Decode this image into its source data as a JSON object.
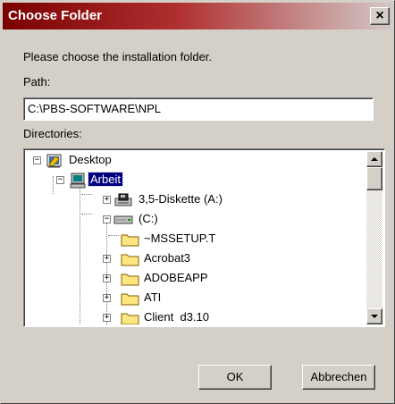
{
  "window": {
    "title": "Choose Folder",
    "close_glyph": "×"
  },
  "prompt": "Please choose the installation folder.",
  "path": {
    "label": "Path:",
    "value": "C:\\PBS-SOFTWARE\\NPL"
  },
  "directories": {
    "label": "Directories:",
    "items": [
      {
        "label": "Desktop",
        "icon": "desktop-icon",
        "expander": "−"
      },
      {
        "label": "Arbeit",
        "icon": "computer-icon",
        "expander": "−",
        "selected": true
      },
      {
        "label": "3,5-Diskette (A:)",
        "icon": "floppy-drive-icon",
        "expander": "+"
      },
      {
        "label": "(C:)",
        "icon": "hard-drive-icon",
        "expander": "−"
      },
      {
        "label": "~MSSETUP.T",
        "icon": "folder-icon",
        "expander": ""
      },
      {
        "label": "Acrobat3",
        "icon": "folder-icon",
        "expander": "+"
      },
      {
        "label": "ADOBEAPP",
        "icon": "folder-icon",
        "expander": "+"
      },
      {
        "label": "ATI",
        "icon": "folder-icon",
        "expander": "+"
      },
      {
        "label": "Client  d3.10",
        "icon": "folder-icon",
        "expander": "+"
      }
    ]
  },
  "buttons": {
    "ok": "OK",
    "cancel": "Abbrechen"
  },
  "colors": {
    "titlebar_start": "#7a0000",
    "selection": "#000080",
    "face": "#d4d0c8"
  }
}
